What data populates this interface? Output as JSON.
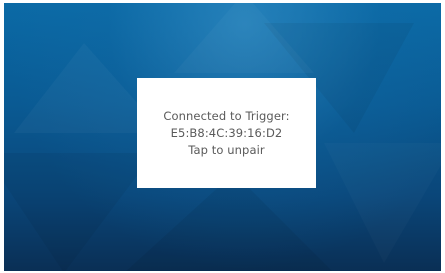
{
  "dialog": {
    "title": "Connected to Trigger:",
    "device_address": "E5:B8:4C:39:16:D2",
    "action_hint": "Tap to unpair"
  },
  "colors": {
    "background_top": "#0b6aa6",
    "background_bottom": "#0a2f55",
    "dialog_background": "#ffffff",
    "dialog_text": "#5a5a5a"
  }
}
